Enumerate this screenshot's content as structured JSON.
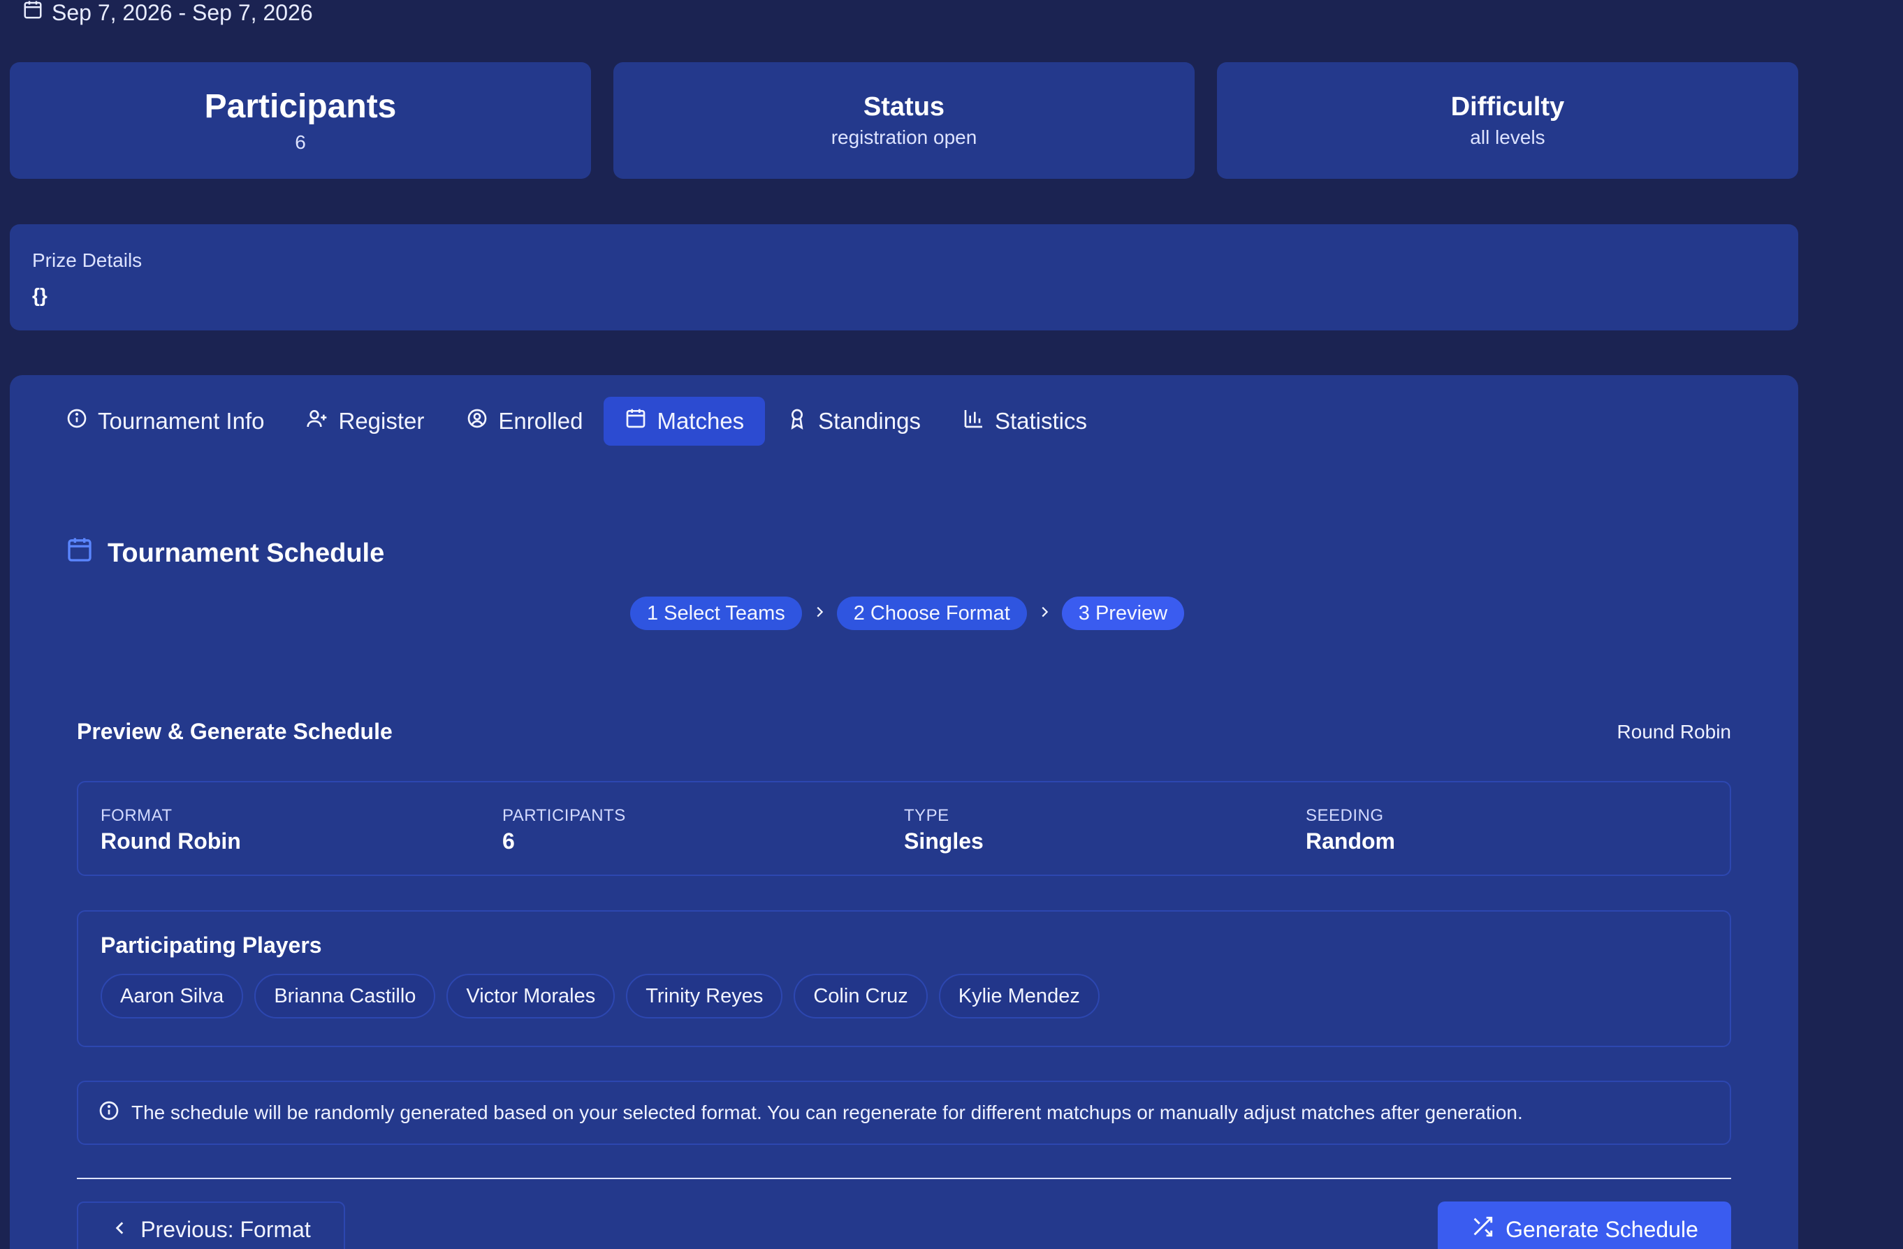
{
  "header": {
    "date_range": "Sep 7, 2026 - Sep 7, 2026"
  },
  "stats": [
    {
      "label": "Participants",
      "value": "6"
    },
    {
      "label": "Status",
      "value": "registration open"
    },
    {
      "label": "Difficulty",
      "value": "all levels"
    }
  ],
  "prize": {
    "title": "Prize Details",
    "body": "{}"
  },
  "tabs": [
    {
      "label": "Tournament Info",
      "icon": "info-icon",
      "active": false
    },
    {
      "label": "Register",
      "icon": "user-plus-icon",
      "active": false
    },
    {
      "label": "Enrolled",
      "icon": "user-circle-icon",
      "active": false
    },
    {
      "label": "Matches",
      "icon": "calendar-icon",
      "active": true
    },
    {
      "label": "Standings",
      "icon": "award-icon",
      "active": false
    },
    {
      "label": "Statistics",
      "icon": "bar-chart-icon",
      "active": false
    }
  ],
  "schedule": {
    "title": "Tournament Schedule",
    "steps": [
      "1 Select Teams",
      "2 Choose Format",
      "3 Preview"
    ],
    "current_step": 3,
    "preview_title": "Preview & Generate Schedule",
    "preview_format": "Round Robin",
    "summary": [
      {
        "key": "FORMAT",
        "value": "Round Robin"
      },
      {
        "key": "PARTICIPANTS",
        "value": "6"
      },
      {
        "key": "TYPE",
        "value": "Singles"
      },
      {
        "key": "SEEDING",
        "value": "Random"
      }
    ],
    "players_title": "Participating Players",
    "players": [
      "Aaron Silva",
      "Brianna Castillo",
      "Victor Morales",
      "Trinity Reyes",
      "Colin Cruz",
      "Kylie Mendez"
    ],
    "notice": "The schedule will be randomly generated based on your selected format. You can regenerate for different matchups or manually adjust matches after generation.",
    "prev_button": "Previous: Format",
    "generate_button": "Generate Schedule"
  },
  "colors": {
    "background": "#1b2352",
    "panel": "#24398c",
    "accent": "#3a5cf0"
  }
}
